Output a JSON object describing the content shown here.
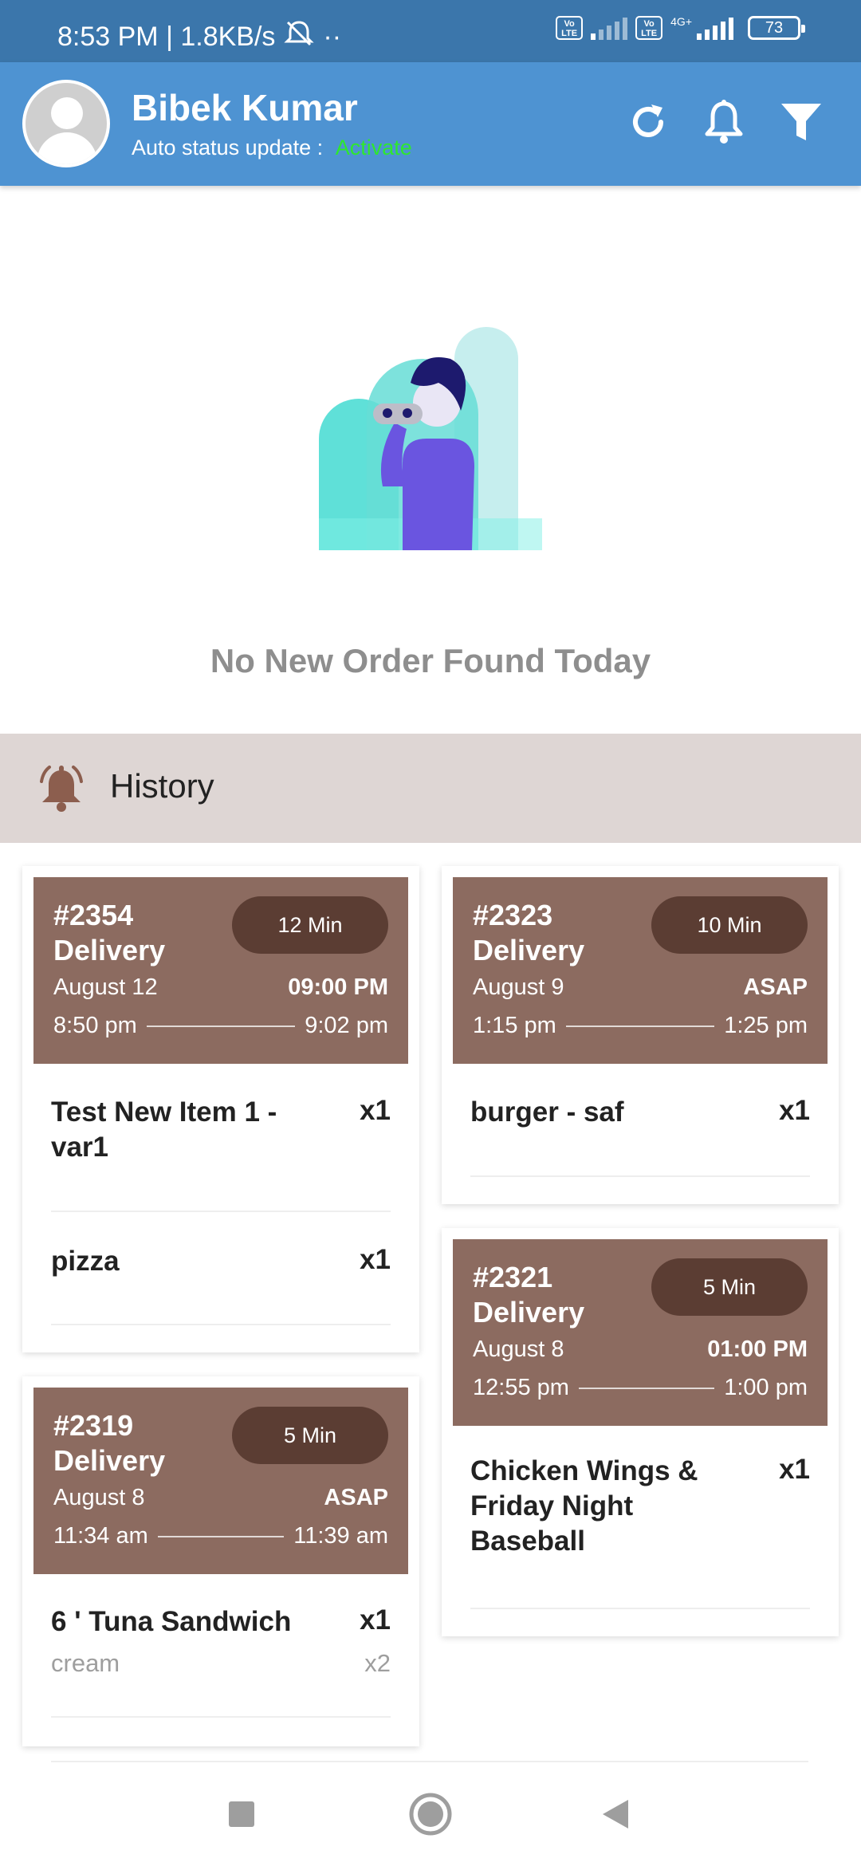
{
  "status_bar": {
    "time_speed": "8:53 PM | 1.8KB/s",
    "dots": "··",
    "volte_label": "Vo\nLTE",
    "network_type": "4G+",
    "battery": "73"
  },
  "header": {
    "user_name": "Bibek Kumar",
    "status_label": "Auto status update :",
    "status_value": "Activate",
    "icons": [
      "refresh-icon",
      "bell-icon",
      "filter-icon"
    ]
  },
  "empty_state": {
    "message": "No New Order Found Today"
  },
  "history": {
    "title": "History"
  },
  "orders": [
    {
      "number": "#2354",
      "type": "Delivery",
      "duration": "12 Min",
      "date": "August 12",
      "time": "09:00 PM",
      "start": "8:50 pm",
      "end": "9:02 pm",
      "items": [
        {
          "name": "Test New Item 1 - var1",
          "qty": "x1"
        },
        {
          "name": "pizza",
          "qty": "x1"
        }
      ]
    },
    {
      "number": "#2323",
      "type": "Delivery",
      "duration": "10 Min",
      "date": "August 9",
      "time": "ASAP",
      "start": "1:15 pm",
      "end": "1:25 pm",
      "items": [
        {
          "name": "burger - saf",
          "qty": "x1"
        }
      ]
    },
    {
      "number": "#2321",
      "type": "Delivery",
      "duration": "5 Min",
      "date": "August 8",
      "time": "01:00 PM",
      "start": "12:55 pm",
      "end": "1:00 pm",
      "items": [
        {
          "name": "Chicken Wings & Friday Night Baseball",
          "qty": "x1"
        }
      ]
    },
    {
      "number": "#2319",
      "type": "Delivery",
      "duration": "5 Min",
      "date": "August 8",
      "time": "ASAP",
      "start": "11:34 am",
      "end": "11:39 am",
      "items": [
        {
          "name": "6 ' Tuna Sandwich",
          "qty": "x1",
          "modifier": "cream",
          "modifier_qty": "x2"
        }
      ]
    }
  ],
  "nav": [
    "recents-button",
    "home-button",
    "back-button"
  ]
}
